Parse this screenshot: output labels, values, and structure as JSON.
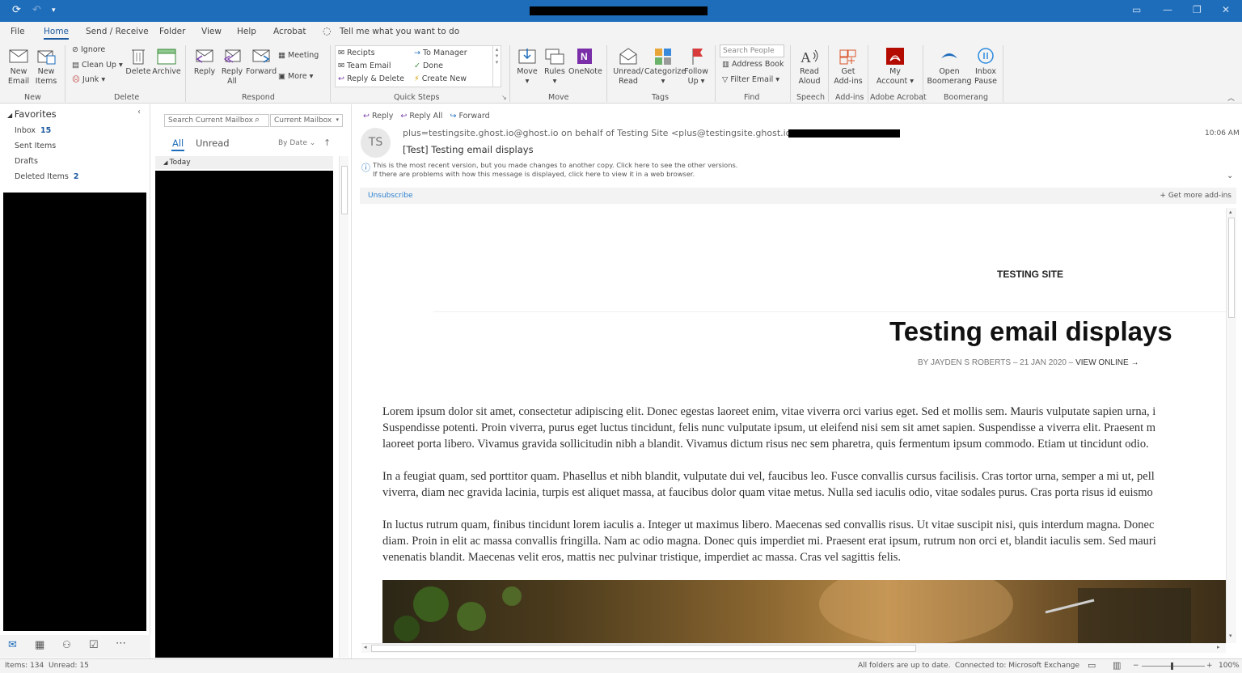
{
  "menu": {
    "tabs": [
      "File",
      "Home",
      "Send / Receive",
      "Folder",
      "View",
      "Help",
      "Acrobat"
    ],
    "tell_me": "Tell me what you want to do"
  },
  "ribbon": {
    "new_email": "New Email",
    "new_items": "New Items",
    "ignore": "Ignore",
    "clean_up": "Clean Up",
    "junk": "Junk",
    "delete": "Delete",
    "archive": "Archive",
    "reply": "Reply",
    "reply_all": "Reply All",
    "forward": "Forward",
    "meeting": "Meeting",
    "more": "More",
    "qs_recipts": "Recipts",
    "qs_team_email": "Team Email",
    "qs_reply_delete": "Reply & Delete",
    "qs_to_manager": "To Manager",
    "qs_done": "Done",
    "qs_create_new": "Create New",
    "move": "Move",
    "rules": "Rules",
    "onenote": "OneNote",
    "unread_read": "Unread/ Read",
    "categorize": "Categorize",
    "follow_up": "Follow Up",
    "search_people": "Search People",
    "address_book": "Address Book",
    "filter_email": "Filter Email",
    "read_aloud": "Read Aloud",
    "get_addins": "Get Add-ins",
    "my_account": "My Account",
    "open_boomerang": "Open Boomerang",
    "inbox_pause": "Inbox Pause",
    "groups": [
      "New",
      "Delete",
      "Respond",
      "Quick Steps",
      "Move",
      "Tags",
      "Find",
      "Speech",
      "Add-ins",
      "Adobe Acrobat",
      "Boomerang"
    ]
  },
  "nav": {
    "favorites": "Favorites",
    "inbox": "Inbox",
    "inbox_count": "15",
    "sent": "Sent Items",
    "drafts": "Drafts",
    "deleted": "Deleted Items",
    "deleted_count": "2"
  },
  "list": {
    "search_placeholder": "Search Current Mailbox",
    "scope": "Current Mailbox",
    "tab_all": "All",
    "tab_unread": "Unread",
    "sort": "By Date",
    "group_today": "Today"
  },
  "message": {
    "reply": "Reply",
    "reply_all": "Reply All",
    "forward": "Forward",
    "avatar": "TS",
    "from": "plus=testingsite.ghost.io@ghost.io on behalf of Testing Site <plus@testingsite.ghost.io>",
    "subject": "[Test] Testing email displays",
    "time": "10:06 AM",
    "info_line1": "This is the most recent version, but you made changes to another copy. Click here to see the other versions.",
    "info_line2": "If there are problems with how this message is displayed, click here to view it in a web browser.",
    "unsubscribe": "Unsubscribe",
    "get_more_addins": "Get more add-ins"
  },
  "email": {
    "site_name": "TESTING SITE",
    "title": "Testing email displays",
    "byline_prefix": "BY JAYDEN S ROBERTS – 21 JAN 2020 –",
    "view_online": "VIEW ONLINE →",
    "p1": [
      "Lorem ipsum dolor sit amet, consectetur adipiscing elit. Donec egestas laoreet enim, vitae viverra orci varius eget. Sed et mollis sem. Mauris vulputate sapien urna, i",
      "Suspendisse potenti. Proin viverra, purus eget luctus tincidunt, felis nunc vulputate ipsum, ut eleifend nisi sem sit amet sapien. Suspendisse a viverra elit. Praesent m",
      "laoreet porta libero. Vivamus gravida sollicitudin nibh a blandit. Vivamus dictum risus nec sem pharetra, quis fermentum ipsum commodo. Etiam ut tincidunt odio."
    ],
    "p2": [
      "In a feugiat quam, sed porttitor quam. Phasellus et nibh blandit, vulputate dui vel, faucibus leo. Fusce convallis cursus facilisis. Cras tortor urna, semper a mi ut, pell",
      "viverra, diam nec gravida lacinia, turpis est aliquet massa, at faucibus dolor quam vitae metus. Nulla sed iaculis odio, vitae sodales purus. Cras porta risus id euismo"
    ],
    "p3": [
      "In luctus rutrum quam, finibus tincidunt lorem iaculis a. Integer ut maximus libero. Maecenas sed convallis risus. Ut vitae suscipit nisi, quis interdum magna. Donec",
      "diam. Proin in elit ac massa convallis fringilla. Nam ac odio magna. Donec quis imperdiet mi. Praesent erat ipsum, rutrum non orci et, blandit iaculis sem. Sed mauri",
      "venenatis blandit. Maecenas velit eros, mattis nec pulvinar tristique, imperdiet ac massa. Cras vel sagittis felis."
    ]
  },
  "status": {
    "items": "Items: 134",
    "unread": "Unread: 15",
    "sync": "All folders are up to date.",
    "connection": "Connected to: Microsoft Exchange",
    "zoom": "100%"
  },
  "colors": {
    "accent": "#1e6dbb",
    "link": "#1e5aa0",
    "ribbon_bg": "#f3f3f3"
  }
}
